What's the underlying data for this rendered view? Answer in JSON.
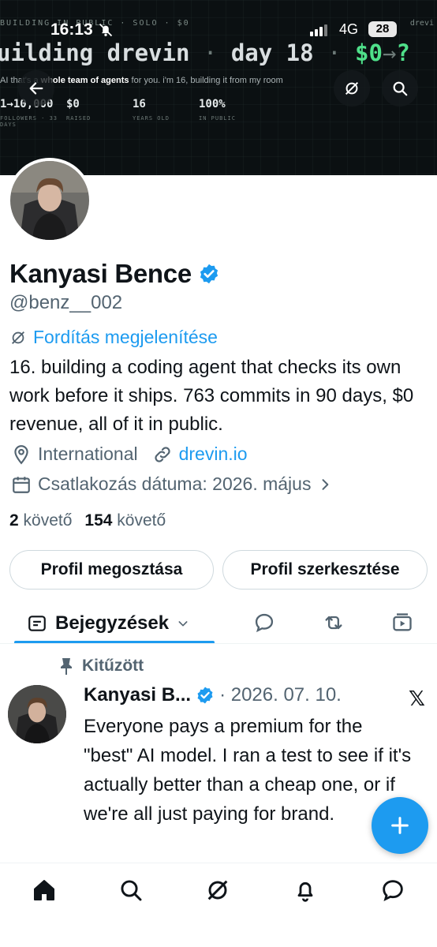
{
  "status_bar": {
    "time": "16:13",
    "network": "4G",
    "battery": "28"
  },
  "banner": {
    "top_line": "BUILDING IN PUBLIC · SOLO · $0",
    "top_right": "drevi",
    "title_prefix": "uilding drevin",
    "title_mid": "day 18",
    "title_money": "$0",
    "title_arrow": "→",
    "title_q": "?",
    "sub_prefix": "AI that's a ",
    "sub_bold": "whole team of agents",
    "sub_suffix": " for you. i'm 16, building it from my room",
    "stats": [
      {
        "value": "1→10,000",
        "label": "FOLLOWERS · 33 DAYS"
      },
      {
        "value": "$0",
        "label": "RAISED"
      },
      {
        "value": "16",
        "label": "YEARS OLD"
      },
      {
        "value": "100%",
        "label": "IN PUBLIC"
      }
    ]
  },
  "profile": {
    "name": "Kanyasi Bence",
    "handle": "@benz__002",
    "translate_label": "Fordítás megjelenítése",
    "bio": "16. building a coding agent that checks its own work before it ships. 763 commits in 90 days, $0 revenue, all of it in public.",
    "location": "International",
    "website": "drevin.io",
    "joined": "Csatlakozás dátuma: 2026. május",
    "following_count": "2",
    "following_label": "követő",
    "followers_count": "154",
    "followers_label": "követő"
  },
  "buttons": {
    "share": "Profil megosztása",
    "edit": "Profil szerkesztése"
  },
  "tabs": {
    "active": "Bejegyzések"
  },
  "pinned_tweet": {
    "pinned_label": "Kitűzött",
    "author": "Kanyasi B...",
    "date": "· 2026. 07. 10.",
    "text": "Everyone pays a premium for the \"best\" AI model. I ran a test to see if it's actually better than a cheap one, or if we're all just paying for brand."
  },
  "colors": {
    "accent": "#1d9bf0",
    "banner_bg": "#0b1012",
    "banner_green": "#4fe08a"
  }
}
